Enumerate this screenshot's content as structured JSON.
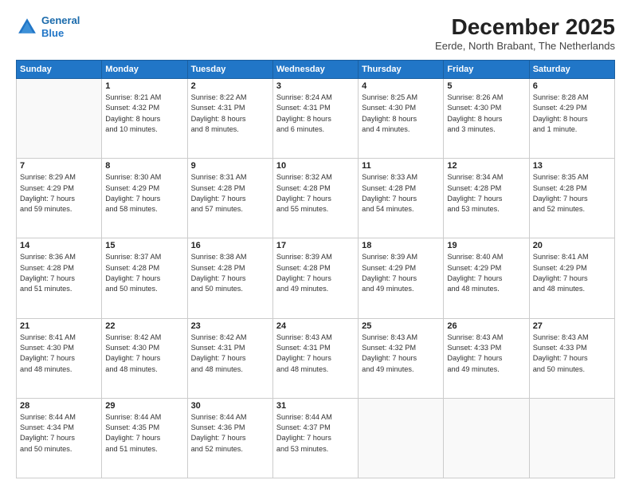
{
  "header": {
    "logo_line1": "General",
    "logo_line2": "Blue",
    "month": "December 2025",
    "location": "Eerde, North Brabant, The Netherlands"
  },
  "weekdays": [
    "Sunday",
    "Monday",
    "Tuesday",
    "Wednesday",
    "Thursday",
    "Friday",
    "Saturday"
  ],
  "weeks": [
    [
      {
        "day": "",
        "info": ""
      },
      {
        "day": "1",
        "info": "Sunrise: 8:21 AM\nSunset: 4:32 PM\nDaylight: 8 hours\nand 10 minutes."
      },
      {
        "day": "2",
        "info": "Sunrise: 8:22 AM\nSunset: 4:31 PM\nDaylight: 8 hours\nand 8 minutes."
      },
      {
        "day": "3",
        "info": "Sunrise: 8:24 AM\nSunset: 4:31 PM\nDaylight: 8 hours\nand 6 minutes."
      },
      {
        "day": "4",
        "info": "Sunrise: 8:25 AM\nSunset: 4:30 PM\nDaylight: 8 hours\nand 4 minutes."
      },
      {
        "day": "5",
        "info": "Sunrise: 8:26 AM\nSunset: 4:30 PM\nDaylight: 8 hours\nand 3 minutes."
      },
      {
        "day": "6",
        "info": "Sunrise: 8:28 AM\nSunset: 4:29 PM\nDaylight: 8 hours\nand 1 minute."
      }
    ],
    [
      {
        "day": "7",
        "info": "Sunrise: 8:29 AM\nSunset: 4:29 PM\nDaylight: 7 hours\nand 59 minutes."
      },
      {
        "day": "8",
        "info": "Sunrise: 8:30 AM\nSunset: 4:29 PM\nDaylight: 7 hours\nand 58 minutes."
      },
      {
        "day": "9",
        "info": "Sunrise: 8:31 AM\nSunset: 4:28 PM\nDaylight: 7 hours\nand 57 minutes."
      },
      {
        "day": "10",
        "info": "Sunrise: 8:32 AM\nSunset: 4:28 PM\nDaylight: 7 hours\nand 55 minutes."
      },
      {
        "day": "11",
        "info": "Sunrise: 8:33 AM\nSunset: 4:28 PM\nDaylight: 7 hours\nand 54 minutes."
      },
      {
        "day": "12",
        "info": "Sunrise: 8:34 AM\nSunset: 4:28 PM\nDaylight: 7 hours\nand 53 minutes."
      },
      {
        "day": "13",
        "info": "Sunrise: 8:35 AM\nSunset: 4:28 PM\nDaylight: 7 hours\nand 52 minutes."
      }
    ],
    [
      {
        "day": "14",
        "info": "Sunrise: 8:36 AM\nSunset: 4:28 PM\nDaylight: 7 hours\nand 51 minutes."
      },
      {
        "day": "15",
        "info": "Sunrise: 8:37 AM\nSunset: 4:28 PM\nDaylight: 7 hours\nand 50 minutes."
      },
      {
        "day": "16",
        "info": "Sunrise: 8:38 AM\nSunset: 4:28 PM\nDaylight: 7 hours\nand 50 minutes."
      },
      {
        "day": "17",
        "info": "Sunrise: 8:39 AM\nSunset: 4:28 PM\nDaylight: 7 hours\nand 49 minutes."
      },
      {
        "day": "18",
        "info": "Sunrise: 8:39 AM\nSunset: 4:29 PM\nDaylight: 7 hours\nand 49 minutes."
      },
      {
        "day": "19",
        "info": "Sunrise: 8:40 AM\nSunset: 4:29 PM\nDaylight: 7 hours\nand 48 minutes."
      },
      {
        "day": "20",
        "info": "Sunrise: 8:41 AM\nSunset: 4:29 PM\nDaylight: 7 hours\nand 48 minutes."
      }
    ],
    [
      {
        "day": "21",
        "info": "Sunrise: 8:41 AM\nSunset: 4:30 PM\nDaylight: 7 hours\nand 48 minutes."
      },
      {
        "day": "22",
        "info": "Sunrise: 8:42 AM\nSunset: 4:30 PM\nDaylight: 7 hours\nand 48 minutes."
      },
      {
        "day": "23",
        "info": "Sunrise: 8:42 AM\nSunset: 4:31 PM\nDaylight: 7 hours\nand 48 minutes."
      },
      {
        "day": "24",
        "info": "Sunrise: 8:43 AM\nSunset: 4:31 PM\nDaylight: 7 hours\nand 48 minutes."
      },
      {
        "day": "25",
        "info": "Sunrise: 8:43 AM\nSunset: 4:32 PM\nDaylight: 7 hours\nand 49 minutes."
      },
      {
        "day": "26",
        "info": "Sunrise: 8:43 AM\nSunset: 4:33 PM\nDaylight: 7 hours\nand 49 minutes."
      },
      {
        "day": "27",
        "info": "Sunrise: 8:43 AM\nSunset: 4:33 PM\nDaylight: 7 hours\nand 50 minutes."
      }
    ],
    [
      {
        "day": "28",
        "info": "Sunrise: 8:44 AM\nSunset: 4:34 PM\nDaylight: 7 hours\nand 50 minutes."
      },
      {
        "day": "29",
        "info": "Sunrise: 8:44 AM\nSunset: 4:35 PM\nDaylight: 7 hours\nand 51 minutes."
      },
      {
        "day": "30",
        "info": "Sunrise: 8:44 AM\nSunset: 4:36 PM\nDaylight: 7 hours\nand 52 minutes."
      },
      {
        "day": "31",
        "info": "Sunrise: 8:44 AM\nSunset: 4:37 PM\nDaylight: 7 hours\nand 53 minutes."
      },
      {
        "day": "",
        "info": ""
      },
      {
        "day": "",
        "info": ""
      },
      {
        "day": "",
        "info": ""
      }
    ]
  ]
}
